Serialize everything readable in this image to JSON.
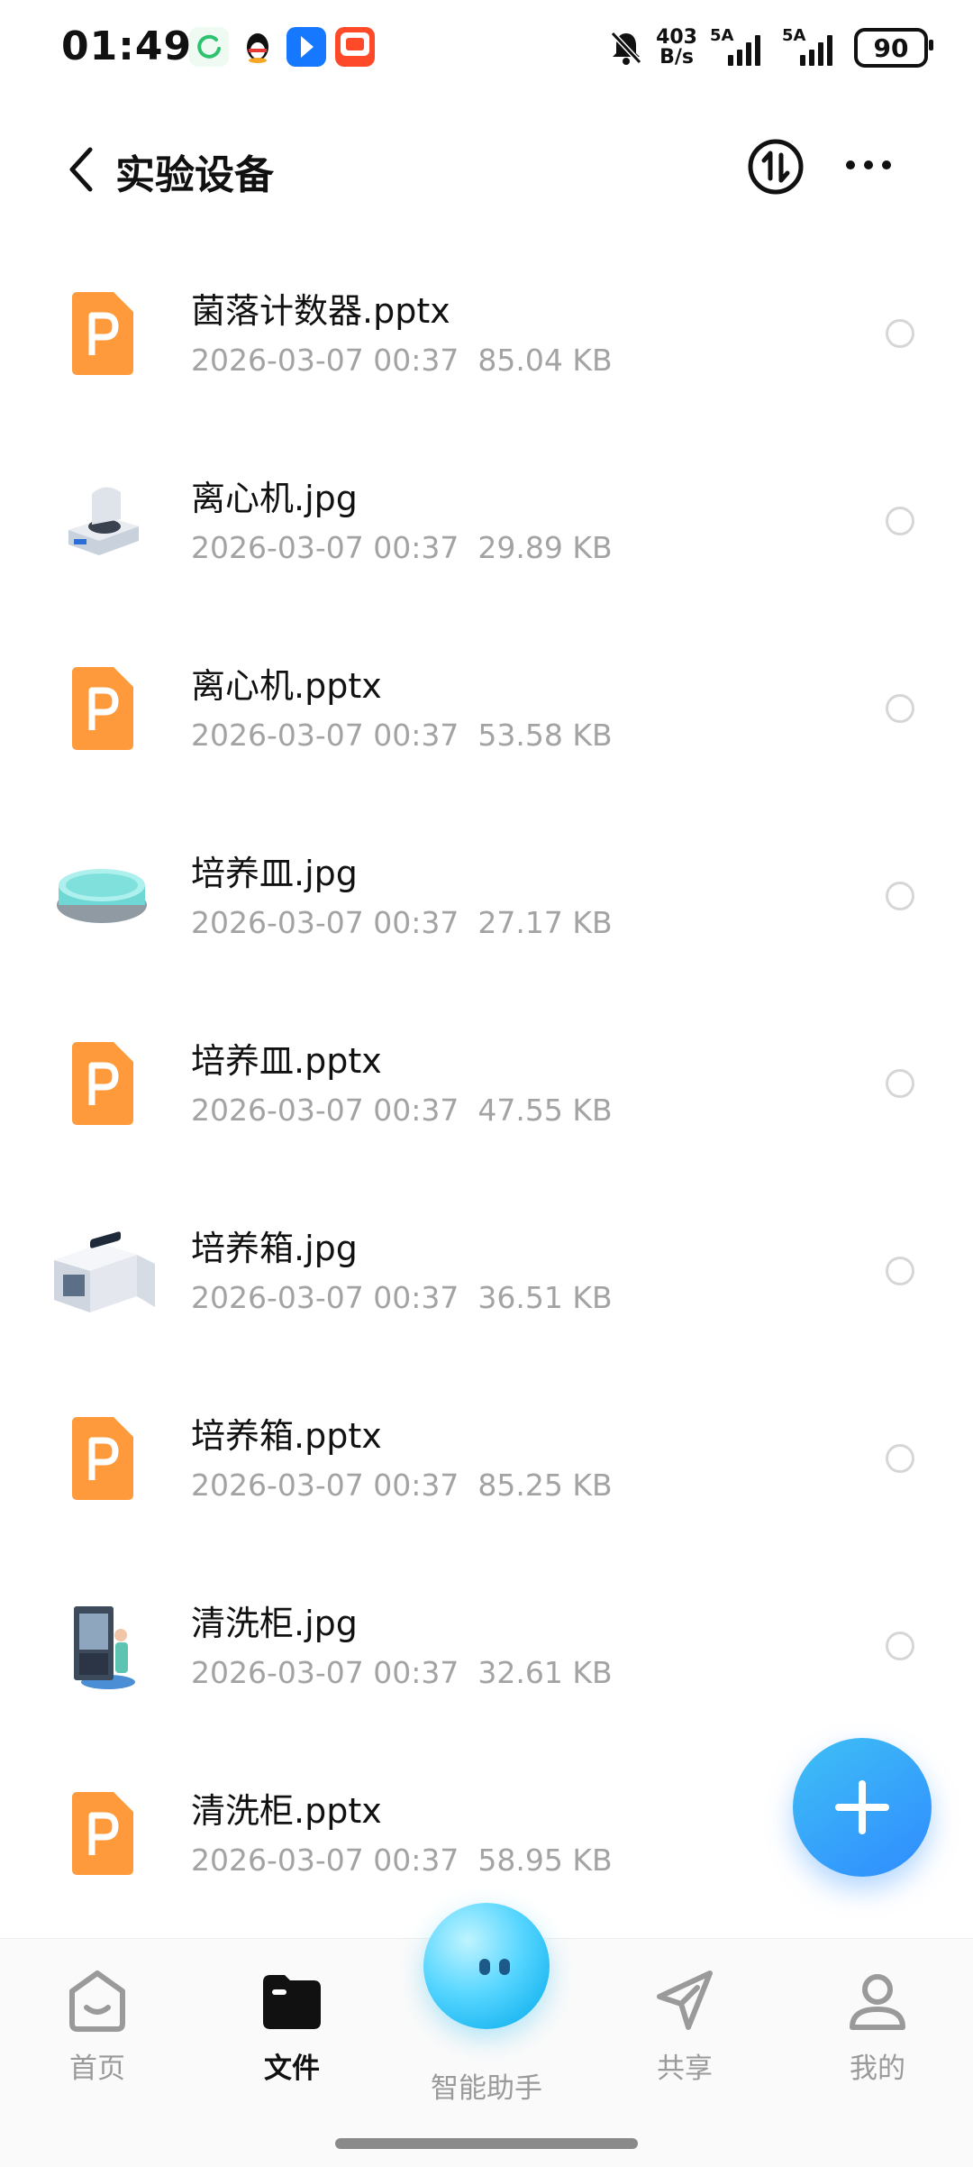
{
  "status_bar": {
    "time": "01:49",
    "net_speed_value": "403",
    "net_speed_unit": "B/s",
    "signal1_label": "5A",
    "signal2_label": "5A",
    "battery": "90"
  },
  "header": {
    "title": "实验设备"
  },
  "files": [
    {
      "name": "菌落计数器.pptx",
      "date": "2026-03-07 00:37",
      "size": "85.04 KB",
      "icon": "pptx-icon"
    },
    {
      "name": "离心机.jpg",
      "date": "2026-03-07 00:37",
      "size": "29.89 KB",
      "icon": "centrifuge-image-icon"
    },
    {
      "name": "离心机.pptx",
      "date": "2026-03-07 00:37",
      "size": "53.58 KB",
      "icon": "pptx-icon"
    },
    {
      "name": "培养皿.jpg",
      "date": "2026-03-07 00:37",
      "size": "27.17 KB",
      "icon": "petri-dish-image-icon"
    },
    {
      "name": "培养皿.pptx",
      "date": "2026-03-07 00:37",
      "size": "47.55 KB",
      "icon": "pptx-icon"
    },
    {
      "name": "培养箱.jpg",
      "date": "2026-03-07 00:37",
      "size": "36.51 KB",
      "icon": "incubator-image-icon"
    },
    {
      "name": "培养箱.pptx",
      "date": "2026-03-07 00:37",
      "size": "85.25 KB",
      "icon": "pptx-icon"
    },
    {
      "name": "清洗柜.jpg",
      "date": "2026-03-07 00:37",
      "size": "32.61 KB",
      "icon": "washer-cabinet-image-icon"
    },
    {
      "name": "清洗柜.pptx",
      "date": "2026-03-07 00:37",
      "size": "58.95 KB",
      "icon": "pptx-icon"
    }
  ],
  "nav": {
    "home": "首页",
    "files": "文件",
    "assistant": "智能助手",
    "share": "共享",
    "me": "我的"
  },
  "colors": {
    "accent": "#2f8bff",
    "pptx": "#ff9a3c",
    "meta_text": "#a3a3a3"
  }
}
